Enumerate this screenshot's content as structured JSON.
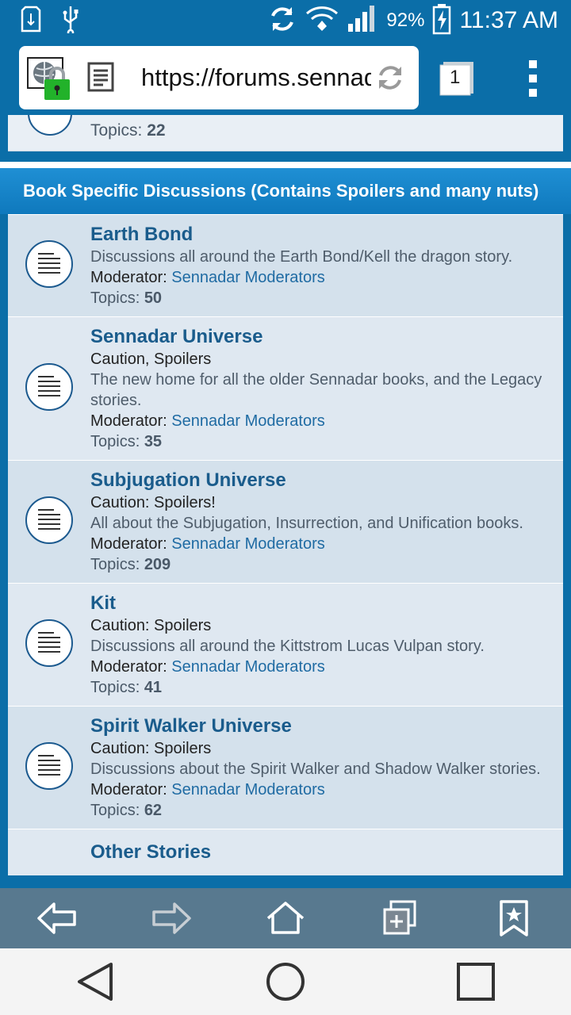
{
  "status_bar": {
    "battery_percent": "92%",
    "time": "11:37 AM"
  },
  "browser": {
    "url": "https://forums.sennadar.com",
    "tab_count": "1"
  },
  "previous_forum": {
    "topics_label": "Topics:",
    "topics_count": "22"
  },
  "section": {
    "title": "Book Specific Discussions (Contains Spoilers and many nuts)"
  },
  "forums": [
    {
      "title": "Earth Bond",
      "caution": "",
      "description": "Discussions all around the Earth Bond/Kell the dragon story.",
      "moderator_label": "Moderator:",
      "moderator": "Sennadar Moderators",
      "topics_label": "Topics:",
      "topics": "50"
    },
    {
      "title": "Sennadar Universe",
      "caution": "Caution, Spoilers",
      "description": "The new home for all the older Sennadar books, and the Legacy stories.",
      "moderator_label": "Moderator:",
      "moderator": "Sennadar Moderators",
      "topics_label": "Topics:",
      "topics": "35"
    },
    {
      "title": "Subjugation Universe",
      "caution": "Caution: Spoilers!",
      "description": "All about the Subjugation, Insurrection, and Unification books.",
      "moderator_label": "Moderator:",
      "moderator": "Sennadar Moderators",
      "topics_label": "Topics:",
      "topics": "209"
    },
    {
      "title": "Kit",
      "caution": "Caution: Spoilers",
      "description": "Discussions all around the Kittstrom Lucas Vulpan story.",
      "moderator_label": "Moderator:",
      "moderator": "Sennadar Moderators",
      "topics_label": "Topics:",
      "topics": "41"
    },
    {
      "title": "Spirit Walker Universe",
      "caution": "Caution: Spoilers",
      "description": "Discussions about the Spirit Walker and Shadow Walker stories.",
      "moderator_label": "Moderator:",
      "moderator": "Sennadar Moderators",
      "topics_label": "Topics:",
      "topics": "62"
    }
  ],
  "next_section": {
    "title": "Other Stories"
  },
  "toolbar_icons": [
    "back-arrow-icon",
    "forward-arrow-icon",
    "home-icon",
    "new-tab-icon",
    "bookmark-icon"
  ],
  "nav_icons": [
    "nav-back-icon",
    "nav-home-icon",
    "nav-recents-icon"
  ],
  "colors": {
    "theme_blue": "#0b6ea8",
    "header_blue": "#1f8fd4",
    "link_blue": "#1f6ba3",
    "title_blue": "#1a5c8c"
  }
}
